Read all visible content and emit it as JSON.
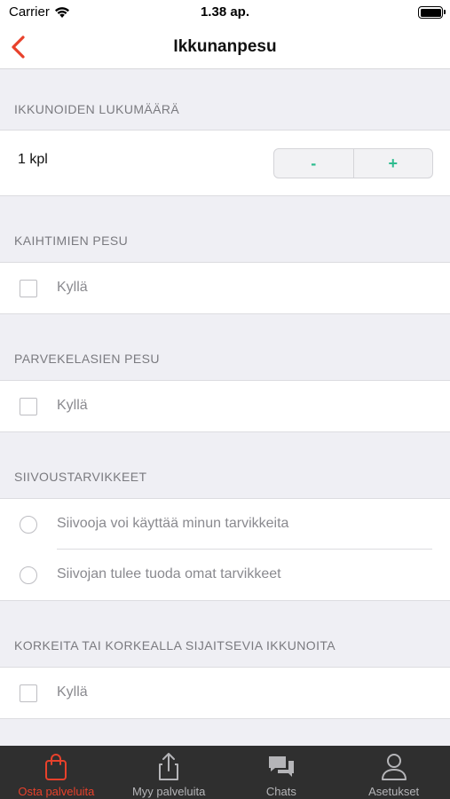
{
  "status_bar": {
    "carrier": "Carrier",
    "time": "1.38 ap."
  },
  "nav": {
    "title": "Ikkunanpesu"
  },
  "colors": {
    "accent": "#e8412b",
    "stepper": "#2ebc8f",
    "tab_bar": "#2f2f2f"
  },
  "sections": {
    "window_count": {
      "header": "IKKUNOIDEN LUKUMÄÄRÄ",
      "value": "1 kpl",
      "minus": "-",
      "plus": "+"
    },
    "blinds": {
      "header": "KAIHTIMIEN PESU",
      "option": "Kyllä",
      "checked": false
    },
    "balcony": {
      "header": "PARVEKELASIEN PESU",
      "option": "Kyllä",
      "checked": false
    },
    "supplies": {
      "header": "SIIVOUSTARVIKKEET",
      "options": [
        "Siivooja voi käyttää minun tarvikkeita",
        "Siivojan tulee tuoda omat tarvikkeet"
      ]
    },
    "high_windows": {
      "header": "KORKEITA TAI KORKEALLA SIJAITSEVIA IKKUNOITA",
      "option": "Kyllä",
      "checked": false
    }
  },
  "tabs": [
    {
      "label": "Osta palveluita",
      "icon": "shopping-bag-icon",
      "active": true
    },
    {
      "label": "Myy palveluita",
      "icon": "share-upload-icon",
      "active": false
    },
    {
      "label": "Chats",
      "icon": "chat-bubbles-icon",
      "active": false
    },
    {
      "label": "Asetukset",
      "icon": "user-profile-icon",
      "active": false
    }
  ]
}
